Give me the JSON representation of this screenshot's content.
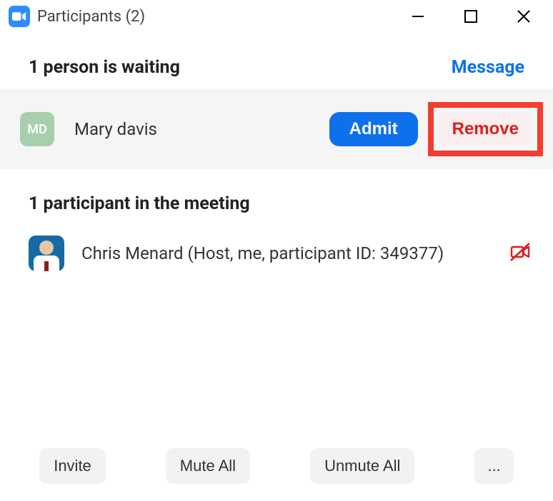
{
  "titlebar": {
    "title": "Participants (2)"
  },
  "waiting": {
    "heading": "1 person is waiting",
    "message_link": "Message",
    "items": [
      {
        "initials": "MD",
        "name": "Mary davis",
        "admit_label": "Admit",
        "remove_label": "Remove"
      }
    ]
  },
  "meeting": {
    "heading": "1 participant in the meeting",
    "items": [
      {
        "name": "Chris Menard (Host, me, participant ID: 349377)",
        "camera_off": true
      }
    ]
  },
  "footer": {
    "invite": "Invite",
    "mute_all": "Mute All",
    "unmute_all": "Unmute All",
    "more": "..."
  }
}
